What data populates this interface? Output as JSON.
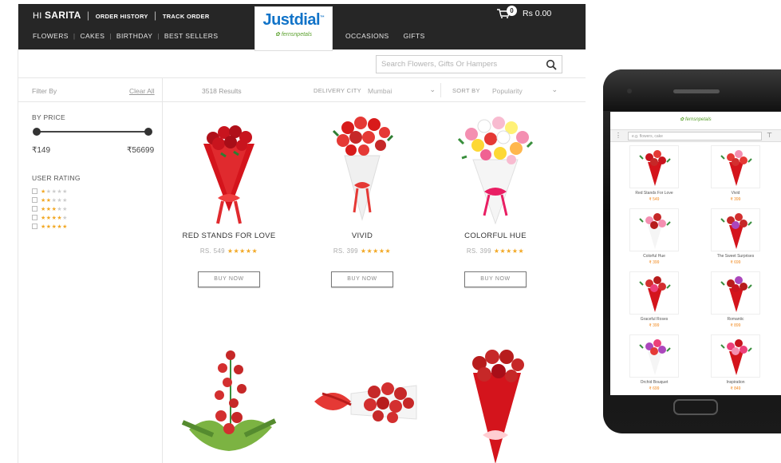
{
  "header": {
    "greeting": "HI",
    "user_name": "SARITA",
    "order_history": "ORDER HISTORY",
    "track_order": "TRACK ORDER",
    "cart_count": "0",
    "cart_total": "Rs 0.00",
    "logo_main": "Justdial",
    "logo_sub": "fernsnpetals",
    "menu_left": [
      "FLOWERS",
      "CAKES",
      "BIRTHDAY",
      "BEST SELLERS"
    ],
    "menu_right": [
      "OCCASIONS",
      "GIFTS"
    ]
  },
  "search": {
    "placeholder": "Search Flowers, Gifts Or Hampers"
  },
  "filter_bar": {
    "filter_by": "Filter By",
    "clear_all": "Clear All",
    "results": "3518 Results",
    "delivery_city_label": "DELIVERY CITY",
    "delivery_city": "Mumbai",
    "sort_by_label": "SORT BY",
    "sort_by": "Popularity"
  },
  "sidebar": {
    "by_price": "BY PRICE",
    "price_min": "₹149",
    "price_max": "₹56699",
    "user_rating": "USER RATING",
    "ratings": [
      1,
      2,
      3,
      4,
      5
    ]
  },
  "products": [
    {
      "name": "RED STANDS FOR LOVE",
      "price": "RS. 549",
      "stars": "★★★★★",
      "button": "BUY NOW",
      "icon": "red-rose-bouquet"
    },
    {
      "name": "VIVID",
      "price": "RS. 399",
      "stars": "★★★★★",
      "button": "BUY NOW",
      "icon": "red-rose-bunch"
    },
    {
      "name": "COLORFUL HUE",
      "price": "RS. 399",
      "stars": "★★★★★",
      "button": "BUY NOW",
      "icon": "mixed-rose-bunch"
    },
    {
      "name": "",
      "price": "",
      "stars": "",
      "button": "",
      "icon": "rose-basket-arrangement"
    },
    {
      "name": "",
      "price": "",
      "stars": "",
      "button": "",
      "icon": "rose-bunch-with-bow"
    },
    {
      "name": "",
      "price": "",
      "stars": "",
      "button": "",
      "icon": "red-rose-bouquet-large"
    }
  ],
  "mobile": {
    "logo": "fernsnpetals",
    "search_placeholder": "e.g. flowers, cake",
    "items": [
      {
        "name": "Red Stands For Love",
        "price": "₹ 549"
      },
      {
        "name": "Vivid",
        "price": "₹ 399"
      },
      {
        "name": "Colorful Hue",
        "price": "₹ 399"
      },
      {
        "name": "The Sweet Surprises",
        "price": "₹ 699"
      },
      {
        "name": "Graceful Roses",
        "price": "₹ 399"
      },
      {
        "name": "Romantic",
        "price": "₹ 899"
      },
      {
        "name": "Orchid Bouquet",
        "price": "₹ 699"
      },
      {
        "name": "Inspiration",
        "price": "₹ 849"
      }
    ]
  },
  "colors": {
    "topbar": "#262626",
    "accent_orange": "#f18a21",
    "brand_blue": "#1173c8",
    "star": "#f2a825",
    "rose": "#c8141e"
  }
}
